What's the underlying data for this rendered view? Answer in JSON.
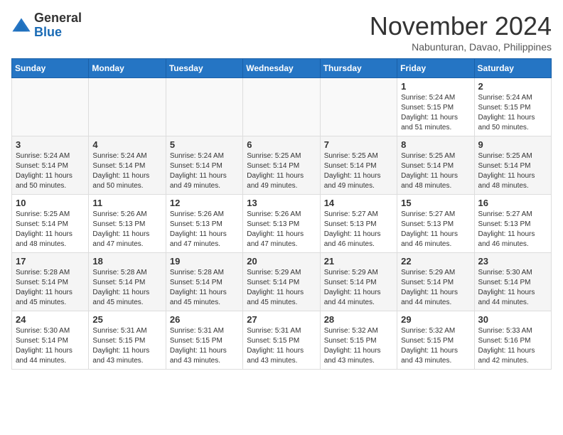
{
  "header": {
    "logo": {
      "general": "General",
      "blue": "Blue"
    },
    "month": "November 2024",
    "location": "Nabunturan, Davao, Philippines"
  },
  "weekdays": [
    "Sunday",
    "Monday",
    "Tuesday",
    "Wednesday",
    "Thursday",
    "Friday",
    "Saturday"
  ],
  "weeks": [
    [
      {
        "day": "",
        "info": ""
      },
      {
        "day": "",
        "info": ""
      },
      {
        "day": "",
        "info": ""
      },
      {
        "day": "",
        "info": ""
      },
      {
        "day": "",
        "info": ""
      },
      {
        "day": "1",
        "info": "Sunrise: 5:24 AM\nSunset: 5:15 PM\nDaylight: 11 hours\nand 51 minutes."
      },
      {
        "day": "2",
        "info": "Sunrise: 5:24 AM\nSunset: 5:15 PM\nDaylight: 11 hours\nand 50 minutes."
      }
    ],
    [
      {
        "day": "3",
        "info": "Sunrise: 5:24 AM\nSunset: 5:14 PM\nDaylight: 11 hours\nand 50 minutes."
      },
      {
        "day": "4",
        "info": "Sunrise: 5:24 AM\nSunset: 5:14 PM\nDaylight: 11 hours\nand 50 minutes."
      },
      {
        "day": "5",
        "info": "Sunrise: 5:24 AM\nSunset: 5:14 PM\nDaylight: 11 hours\nand 49 minutes."
      },
      {
        "day": "6",
        "info": "Sunrise: 5:25 AM\nSunset: 5:14 PM\nDaylight: 11 hours\nand 49 minutes."
      },
      {
        "day": "7",
        "info": "Sunrise: 5:25 AM\nSunset: 5:14 PM\nDaylight: 11 hours\nand 49 minutes."
      },
      {
        "day": "8",
        "info": "Sunrise: 5:25 AM\nSunset: 5:14 PM\nDaylight: 11 hours\nand 48 minutes."
      },
      {
        "day": "9",
        "info": "Sunrise: 5:25 AM\nSunset: 5:14 PM\nDaylight: 11 hours\nand 48 minutes."
      }
    ],
    [
      {
        "day": "10",
        "info": "Sunrise: 5:25 AM\nSunset: 5:14 PM\nDaylight: 11 hours\nand 48 minutes."
      },
      {
        "day": "11",
        "info": "Sunrise: 5:26 AM\nSunset: 5:13 PM\nDaylight: 11 hours\nand 47 minutes."
      },
      {
        "day": "12",
        "info": "Sunrise: 5:26 AM\nSunset: 5:13 PM\nDaylight: 11 hours\nand 47 minutes."
      },
      {
        "day": "13",
        "info": "Sunrise: 5:26 AM\nSunset: 5:13 PM\nDaylight: 11 hours\nand 47 minutes."
      },
      {
        "day": "14",
        "info": "Sunrise: 5:27 AM\nSunset: 5:13 PM\nDaylight: 11 hours\nand 46 minutes."
      },
      {
        "day": "15",
        "info": "Sunrise: 5:27 AM\nSunset: 5:13 PM\nDaylight: 11 hours\nand 46 minutes."
      },
      {
        "day": "16",
        "info": "Sunrise: 5:27 AM\nSunset: 5:13 PM\nDaylight: 11 hours\nand 46 minutes."
      }
    ],
    [
      {
        "day": "17",
        "info": "Sunrise: 5:28 AM\nSunset: 5:14 PM\nDaylight: 11 hours\nand 45 minutes."
      },
      {
        "day": "18",
        "info": "Sunrise: 5:28 AM\nSunset: 5:14 PM\nDaylight: 11 hours\nand 45 minutes."
      },
      {
        "day": "19",
        "info": "Sunrise: 5:28 AM\nSunset: 5:14 PM\nDaylight: 11 hours\nand 45 minutes."
      },
      {
        "day": "20",
        "info": "Sunrise: 5:29 AM\nSunset: 5:14 PM\nDaylight: 11 hours\nand 45 minutes."
      },
      {
        "day": "21",
        "info": "Sunrise: 5:29 AM\nSunset: 5:14 PM\nDaylight: 11 hours\nand 44 minutes."
      },
      {
        "day": "22",
        "info": "Sunrise: 5:29 AM\nSunset: 5:14 PM\nDaylight: 11 hours\nand 44 minutes."
      },
      {
        "day": "23",
        "info": "Sunrise: 5:30 AM\nSunset: 5:14 PM\nDaylight: 11 hours\nand 44 minutes."
      }
    ],
    [
      {
        "day": "24",
        "info": "Sunrise: 5:30 AM\nSunset: 5:14 PM\nDaylight: 11 hours\nand 44 minutes."
      },
      {
        "day": "25",
        "info": "Sunrise: 5:31 AM\nSunset: 5:15 PM\nDaylight: 11 hours\nand 43 minutes."
      },
      {
        "day": "26",
        "info": "Sunrise: 5:31 AM\nSunset: 5:15 PM\nDaylight: 11 hours\nand 43 minutes."
      },
      {
        "day": "27",
        "info": "Sunrise: 5:31 AM\nSunset: 5:15 PM\nDaylight: 11 hours\nand 43 minutes."
      },
      {
        "day": "28",
        "info": "Sunrise: 5:32 AM\nSunset: 5:15 PM\nDaylight: 11 hours\nand 43 minutes."
      },
      {
        "day": "29",
        "info": "Sunrise: 5:32 AM\nSunset: 5:15 PM\nDaylight: 11 hours\nand 43 minutes."
      },
      {
        "day": "30",
        "info": "Sunrise: 5:33 AM\nSunset: 5:16 PM\nDaylight: 11 hours\nand 42 minutes."
      }
    ]
  ]
}
